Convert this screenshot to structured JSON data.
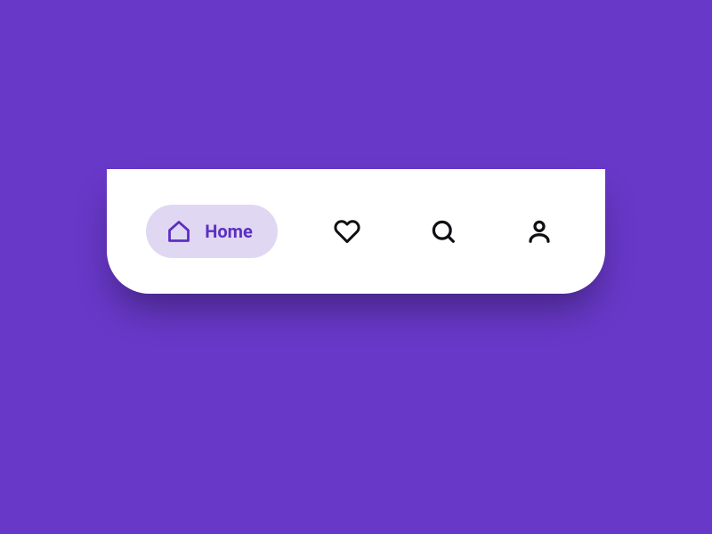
{
  "nav": {
    "items": [
      {
        "name": "home",
        "label": "Home",
        "active": true
      },
      {
        "name": "favorites",
        "label": "Favorites",
        "active": false
      },
      {
        "name": "search",
        "label": "Search",
        "active": false
      },
      {
        "name": "profile",
        "label": "Profile",
        "active": false
      }
    ]
  },
  "colors": {
    "background": "#6838c8",
    "surface": "#ffffff",
    "accent": "#5b2fc3",
    "accent_light": "#e0d7f3",
    "icon_inactive": "#0f0f14"
  }
}
